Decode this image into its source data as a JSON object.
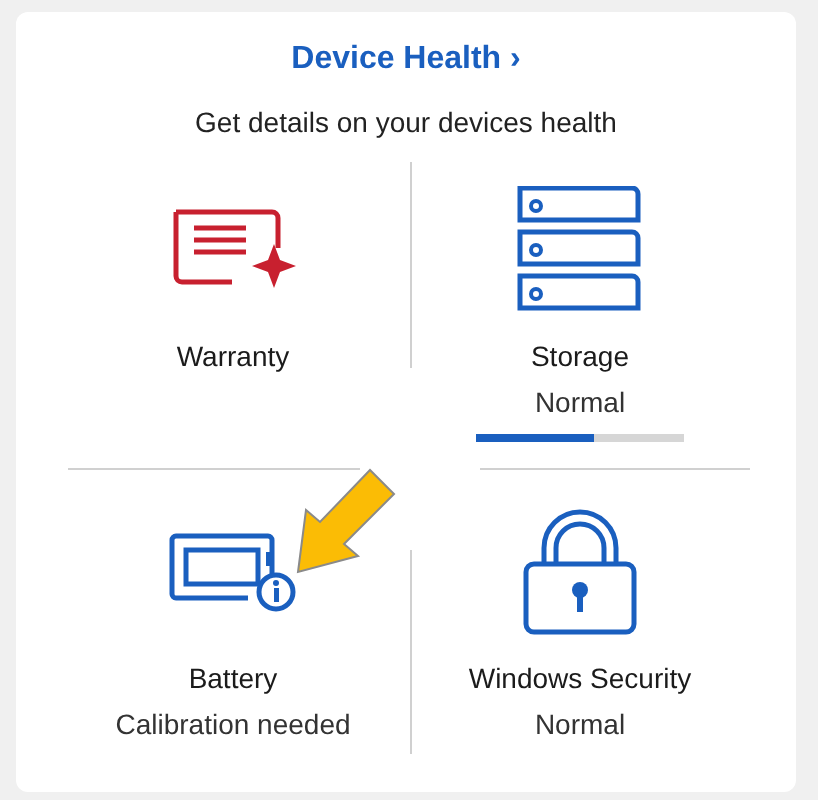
{
  "card": {
    "title": "Device Health ›",
    "subtitle": "Get details on your devices health"
  },
  "tiles": [
    {
      "kind": "warranty",
      "label": "Warranty"
    },
    {
      "kind": "storage",
      "label": "Storage",
      "status": "Normal",
      "level": 0.57
    },
    {
      "kind": "battery",
      "label": "Battery",
      "status": "Calibration needed"
    },
    {
      "kind": "security",
      "label": "Windows Security",
      "status": "Normal"
    }
  ]
}
